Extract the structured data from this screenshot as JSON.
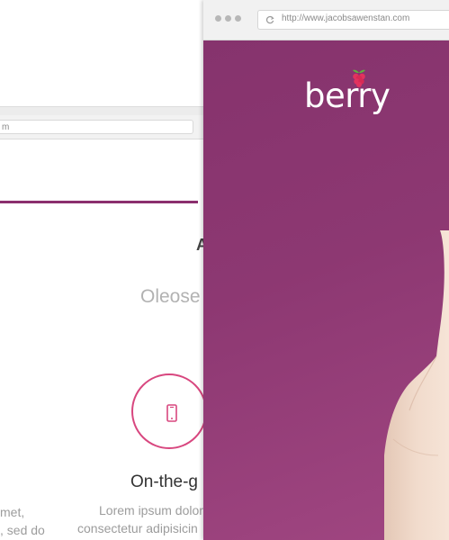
{
  "back_window": {
    "url_fragment": "m",
    "heading_fragment": "A",
    "subtitle": "Oleose",
    "feature": {
      "icon": "smartphone-icon",
      "title": "On-the-g",
      "desc_line1": "Lorem ipsum dolor",
      "desc_line2": "consectetur adipisicin"
    },
    "left_text": {
      "line1": "met,",
      "line2": ", sed do"
    },
    "accent_color": "#8b2f6e"
  },
  "front_window": {
    "url": "http://www.jacobsawenstan.com",
    "logo_text": "berry",
    "logo_icon": "raspberry-icon",
    "hero_color": "#8d3872"
  }
}
